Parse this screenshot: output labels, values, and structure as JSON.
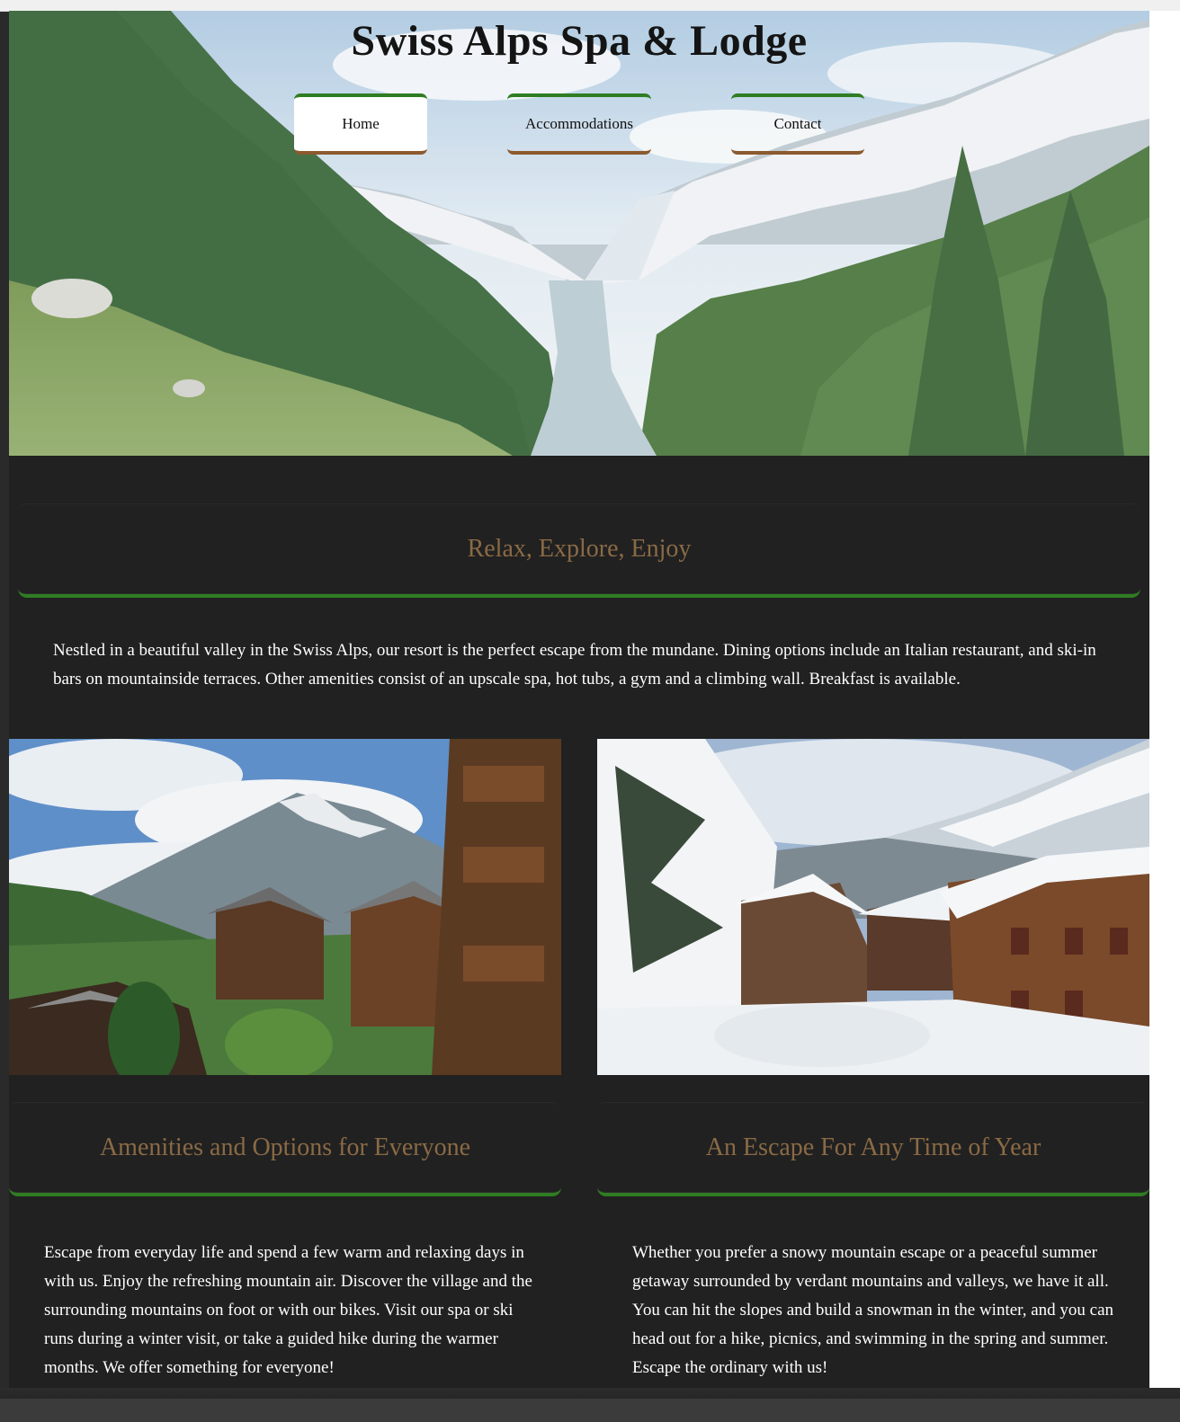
{
  "site": {
    "title": "Swiss Alps Spa & Lodge"
  },
  "nav": {
    "items": [
      {
        "label": "Home"
      },
      {
        "label": "Accommodations"
      },
      {
        "label": "Contact"
      }
    ]
  },
  "intro": {
    "heading": "Relax, Explore, Enjoy",
    "text": "Nestled in a beautiful valley in the Swiss Alps, our resort is the perfect escape from the mundane. Dining options include an Italian restaurant, and ski-in bars on mountainside terraces. Other amenities consist of an upscale spa, hot tubs, a gym and a climbing wall. Breakfast is available."
  },
  "amenities": {
    "heading": "Amenities and Options for Everyone",
    "text": "Escape from everyday life and spend a few warm and relaxing days in with us. Enjoy the refreshing mountain air. Discover the village and the surrounding mountains on foot or with our bikes. Visit our spa or ski runs during a winter visit, or take a guided hike during the warmer months. We offer something for everyone!"
  },
  "escape": {
    "heading": "An Escape For Any Time of Year",
    "text": "Whether you prefer a snowy mountain escape or a peaceful summer getaway surrounded by verdant mountains and valleys, we have it all. You can hit the slopes and build a snowman in the winter, and you can head out for a hike, picnics, and swimming in the spring and summer. Escape the ordinary with us!"
  },
  "colors": {
    "accent_green": "#2f7d22",
    "accent_brown": "#8c5a2e",
    "heading_gold": "#8a6a45",
    "page_bg": "#212121"
  }
}
